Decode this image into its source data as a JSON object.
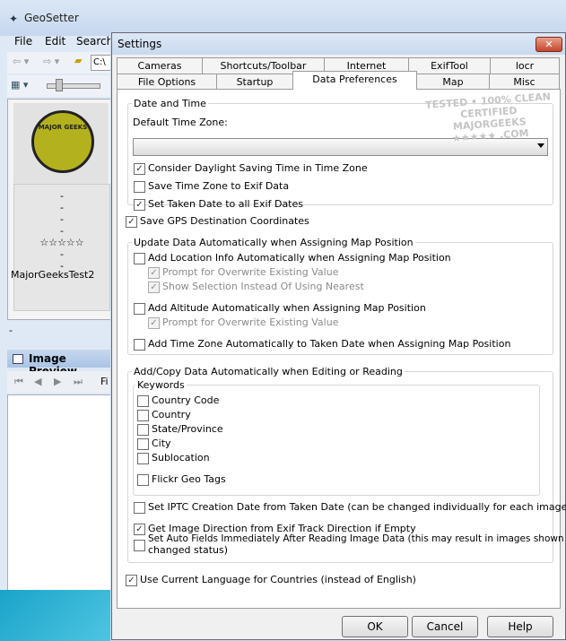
{
  "app": {
    "title": "GeoSetter",
    "menu": [
      "File",
      "Edit",
      "Search"
    ],
    "path_value": "C:\\",
    "thumb_name": "MajorGeeksTest2",
    "thumb_logo_text": "MAJOR GEEKS",
    "thumb_dashes": [
      "-",
      "-",
      "-",
      "-",
      "-",
      "-"
    ],
    "thumb_stars": "☆☆☆☆☆",
    "status_dash": "-",
    "preview_title": "Image Preview",
    "preview_nav_label": "Fi"
  },
  "dialog": {
    "title": "Settings",
    "close": "✕",
    "tabs_row1": [
      "Cameras",
      "Shortcuts/Toolbar",
      "Internet",
      "ExifTool",
      "locr"
    ],
    "tabs_row2": [
      "File Options",
      "Startup",
      "Data Preferences",
      "Map",
      "Misc"
    ],
    "date_time": {
      "title": "Date and Time",
      "tz_label": "Default Time Zone:",
      "tz_value": "",
      "daylight": "Consider Daylight Saving Time in Time Zone",
      "save_tz": "Save Time Zone to Exif Data",
      "taken_date": "Set Taken Date to all Exif Dates"
    },
    "save_gps": "Save GPS Destination Coordinates",
    "update": {
      "title": "Update Data Automatically when Assigning Map Position",
      "location": "Add Location Info Automatically when Assigning Map Position",
      "prompt1": "Prompt for Overwrite Existing Value",
      "selection": "Show Selection Instead Of Using Nearest",
      "altitude": "Add Altitude Automatically when Assigning Map Position",
      "prompt2": "Prompt for Overwrite Existing Value",
      "timezone": "Add Time Zone Automatically to Taken Date when Assigning Map Position"
    },
    "addcopy": {
      "title": "Add/Copy Data Automatically when Editing or Reading",
      "keywords_title": "Keywords",
      "keywords": [
        "Country Code",
        "Country",
        "State/Province",
        "City",
        "Sublocation"
      ],
      "flickr": "Flickr Geo Tags",
      "iptc": "Set IPTC Creation Date from Taken Date (can be changed individually for each image)",
      "direction": "Get Image Direction from Exif Track Direction if Empty",
      "auto_fields_1": "Set Auto Fields Immediately After Reading Image Data (this may result in images shown with",
      "auto_fields_2": "changed status)"
    },
    "use_language": "Use Current Language for Countries (instead of English)",
    "buttons": {
      "ok": "OK",
      "cancel": "Cancel",
      "help": "Help"
    },
    "check_mark": "✓"
  },
  "watermark": {
    "line1": "TESTED • 100% CLEAN",
    "line2": "CERTIFIED",
    "line3": "MAJORGEEKS",
    "line4": "★★★★★ .COM"
  }
}
